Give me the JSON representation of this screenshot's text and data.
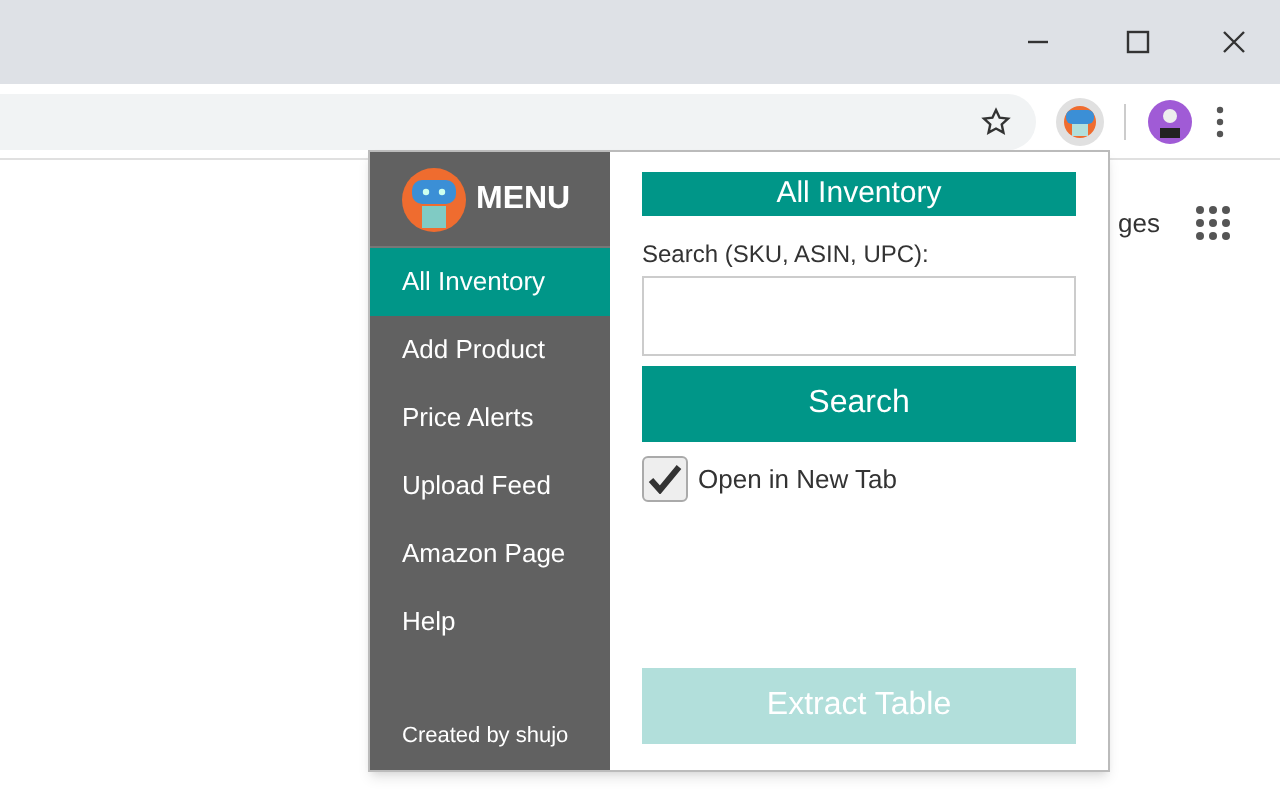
{
  "page_text": "ges",
  "menu": {
    "title": "MENU",
    "items": [
      {
        "label": "All Inventory",
        "selected": true
      },
      {
        "label": "Add Product",
        "selected": false
      },
      {
        "label": "Price Alerts",
        "selected": false
      },
      {
        "label": "Upload Feed",
        "selected": false
      },
      {
        "label": "Amazon Page",
        "selected": false
      },
      {
        "label": "Help",
        "selected": false
      }
    ],
    "credit": "Created by shujo"
  },
  "panel": {
    "title": "All Inventory",
    "search_label": "Search (SKU, ASIN, UPC):",
    "search_button": "Search",
    "open_in_new_tab": {
      "label": "Open in New Tab",
      "checked": true
    },
    "extract_button": {
      "label": "Extract Table",
      "disabled": true
    }
  }
}
